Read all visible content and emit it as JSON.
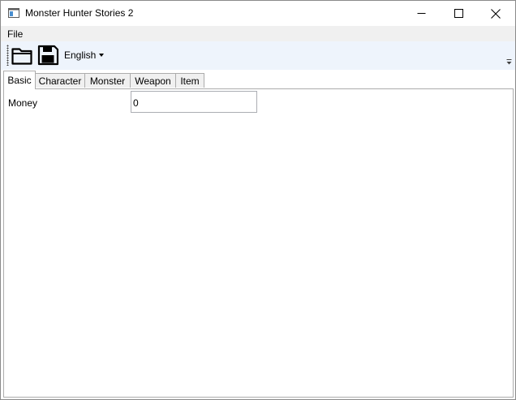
{
  "window": {
    "title": "Monster Hunter Stories 2"
  },
  "menu": {
    "items": [
      {
        "label": "File"
      }
    ]
  },
  "toolbar": {
    "open_icon": "folder-open-icon",
    "save_icon": "save-icon",
    "language": "English"
  },
  "tabs": [
    {
      "label": "Basic",
      "active": true
    },
    {
      "label": "Character",
      "active": false
    },
    {
      "label": "Monster",
      "active": false
    },
    {
      "label": "Weapon",
      "active": false
    },
    {
      "label": "Item",
      "active": false
    }
  ],
  "basic": {
    "money_label": "Money",
    "money_value": "0"
  }
}
